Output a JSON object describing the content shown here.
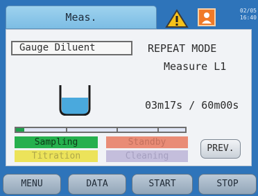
{
  "header": {
    "tab_label": "Meas.",
    "datetime_line1": "02/05",
    "datetime_line2": "16:40"
  },
  "main": {
    "gauge_label": "Gauge Diluent",
    "mode": "REPEAT MODE",
    "measure": "Measure L1",
    "timer": "03m17s / 60m00s",
    "progress_fraction": 0.05,
    "status": {
      "sampling": "Sampling",
      "standby": "Standby",
      "titration": "Titration",
      "cleaning": "Cleaning"
    },
    "prev_label": "PREV."
  },
  "footer": {
    "menu": "MENU",
    "data": "DATA",
    "start": "START",
    "stop": "STOP"
  },
  "colors": {
    "active_status": "#26b04e",
    "progress_fill": "#1fa04c",
    "beaker_liquid": "#4aa9dd"
  },
  "icons": [
    "warning-icon",
    "user-icon",
    "beaker-icon"
  ]
}
